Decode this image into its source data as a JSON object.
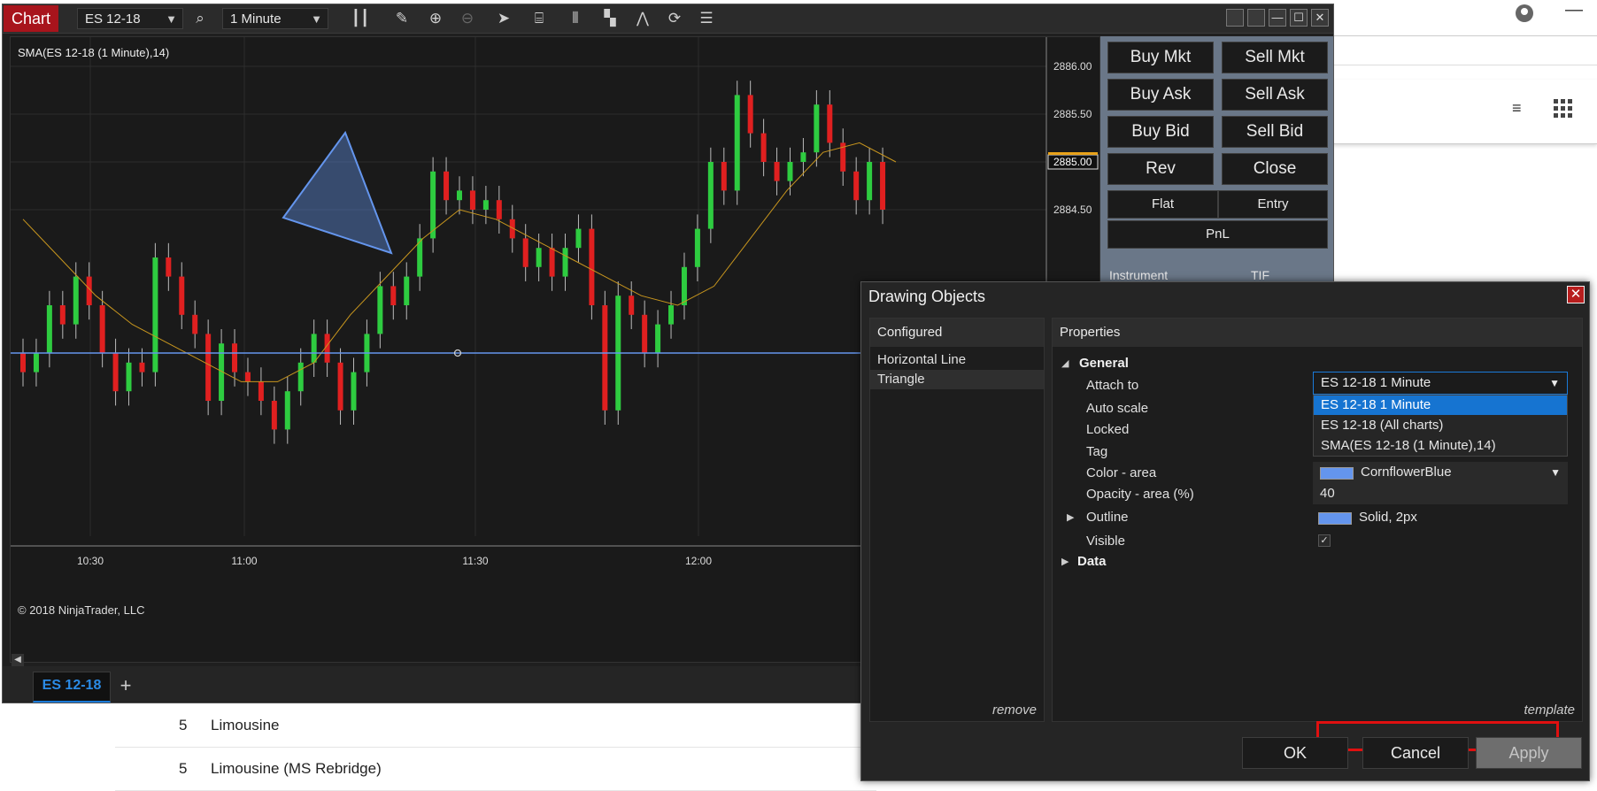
{
  "background_page": {
    "rows": [
      {
        "num": "5",
        "text": "Limousine"
      },
      {
        "num": "5",
        "text": "Limousine (MS Rebridge)"
      }
    ]
  },
  "chart_window": {
    "title_badge": "Chart",
    "instrument": "ES 12-18",
    "interval": "1 Minute",
    "indicator_label": "SMA(ES 12-18 (1 Minute),14)",
    "copyright": "© 2018 NinjaTrader, LLC",
    "active_tab": "ES 12-18",
    "add_tab_label": "+",
    "window_controls": {
      "minimize": "—",
      "maximize": "☐",
      "close": "✕"
    }
  },
  "chart_data": {
    "type": "candlestick",
    "y_axis_labels": [
      "2886.00",
      "2885.50",
      "2885.00",
      "2884.50"
    ],
    "y_ticks": [
      2886.0,
      2885.5,
      2885.0,
      2884.5
    ],
    "last_price_label": "2885.00",
    "last_price": 2885.0,
    "x_tick_labels": [
      "10:30",
      "11:00",
      "11:30",
      "12:00"
    ],
    "horizontal_line_price": 2883.0,
    "sma_color": "#c8961e",
    "up_color": "#2ecc40",
    "down_color": "#e02020",
    "horizontal_line_color": "#6495ed",
    "triangle_color": "#6495ed",
    "candles": [
      {
        "o": 2883.0,
        "c": 2882.8
      },
      {
        "o": 2882.8,
        "c": 2883.0
      },
      {
        "o": 2883.0,
        "c": 2883.5
      },
      {
        "o": 2883.5,
        "c": 2883.3
      },
      {
        "o": 2883.3,
        "c": 2883.8
      },
      {
        "o": 2883.8,
        "c": 2883.5
      },
      {
        "o": 2883.5,
        "c": 2883.0
      },
      {
        "o": 2883.0,
        "c": 2882.6
      },
      {
        "o": 2882.6,
        "c": 2882.9
      },
      {
        "o": 2882.9,
        "c": 2882.8
      },
      {
        "o": 2882.8,
        "c": 2884.0
      },
      {
        "o": 2884.0,
        "c": 2883.8
      },
      {
        "o": 2883.8,
        "c": 2883.4
      },
      {
        "o": 2883.4,
        "c": 2883.2
      },
      {
        "o": 2883.2,
        "c": 2882.5
      },
      {
        "o": 2882.5,
        "c": 2883.1
      },
      {
        "o": 2883.1,
        "c": 2882.8
      },
      {
        "o": 2882.8,
        "c": 2882.7
      },
      {
        "o": 2882.7,
        "c": 2882.5
      },
      {
        "o": 2882.5,
        "c": 2882.2
      },
      {
        "o": 2882.2,
        "c": 2882.6
      },
      {
        "o": 2882.6,
        "c": 2882.9
      },
      {
        "o": 2882.9,
        "c": 2883.2
      },
      {
        "o": 2883.2,
        "c": 2882.9
      },
      {
        "o": 2882.9,
        "c": 2882.4
      },
      {
        "o": 2882.4,
        "c": 2882.8
      },
      {
        "o": 2882.8,
        "c": 2883.2
      },
      {
        "o": 2883.2,
        "c": 2883.7
      },
      {
        "o": 2883.7,
        "c": 2883.5
      },
      {
        "o": 2883.5,
        "c": 2883.8
      },
      {
        "o": 2883.8,
        "c": 2884.2
      },
      {
        "o": 2884.2,
        "c": 2884.9
      },
      {
        "o": 2884.9,
        "c": 2884.6
      },
      {
        "o": 2884.6,
        "c": 2884.7
      },
      {
        "o": 2884.7,
        "c": 2884.5
      },
      {
        "o": 2884.5,
        "c": 2884.6
      },
      {
        "o": 2884.6,
        "c": 2884.4
      },
      {
        "o": 2884.4,
        "c": 2884.2
      },
      {
        "o": 2884.2,
        "c": 2883.9
      },
      {
        "o": 2883.9,
        "c": 2884.1
      },
      {
        "o": 2884.1,
        "c": 2883.8
      },
      {
        "o": 2883.8,
        "c": 2884.1
      },
      {
        "o": 2884.1,
        "c": 2884.3
      },
      {
        "o": 2884.3,
        "c": 2883.5
      },
      {
        "o": 2883.5,
        "c": 2882.4
      },
      {
        "o": 2882.4,
        "c": 2883.6
      },
      {
        "o": 2883.6,
        "c": 2883.4
      },
      {
        "o": 2883.4,
        "c": 2883.0
      },
      {
        "o": 2883.0,
        "c": 2883.3
      },
      {
        "o": 2883.3,
        "c": 2883.5
      },
      {
        "o": 2883.5,
        "c": 2883.9
      },
      {
        "o": 2883.9,
        "c": 2884.3
      },
      {
        "o": 2884.3,
        "c": 2885.0
      },
      {
        "o": 2885.0,
        "c": 2884.7
      },
      {
        "o": 2884.7,
        "c": 2885.7
      },
      {
        "o": 2885.7,
        "c": 2885.3
      },
      {
        "o": 2885.3,
        "c": 2885.0
      },
      {
        "o": 2885.0,
        "c": 2884.8
      },
      {
        "o": 2884.8,
        "c": 2885.0
      },
      {
        "o": 2885.0,
        "c": 2885.1
      },
      {
        "o": 2885.1,
        "c": 2885.6
      },
      {
        "o": 2885.6,
        "c": 2885.2
      },
      {
        "o": 2885.2,
        "c": 2884.9
      },
      {
        "o": 2884.9,
        "c": 2884.6
      },
      {
        "o": 2884.6,
        "c": 2885.0
      },
      {
        "o": 2885.0,
        "c": 2884.5
      }
    ],
    "sma": [
      2884.4,
      2884.0,
      2883.6,
      2883.3,
      2883.1,
      2882.9,
      2882.7,
      2882.7,
      2882.9,
      2883.4,
      2883.8,
      2884.2,
      2884.5,
      2884.4,
      2884.2,
      2884.0,
      2883.8,
      2883.6,
      2883.5,
      2883.7,
      2884.2,
      2884.7,
      2885.1,
      2885.2,
      2885.0
    ]
  },
  "order_panel": {
    "buttons": [
      {
        "label": "Buy Mkt"
      },
      {
        "label": "Sell Mkt"
      },
      {
        "label": "Buy Ask"
      },
      {
        "label": "Sell Ask"
      },
      {
        "label": "Buy Bid"
      },
      {
        "label": "Sell Bid"
      },
      {
        "label": "Rev"
      },
      {
        "label": "Close"
      },
      {
        "label": "Flat"
      },
      {
        "label": "Entry"
      }
    ],
    "pnl_label": "PnL",
    "instrument_label": "Instrument",
    "tif_label": "TIF"
  },
  "dialog": {
    "title": "Drawing Objects",
    "close_label": "✕",
    "configured": {
      "header": "Configured",
      "items": [
        "Horizontal Line",
        "Triangle"
      ],
      "remove_label": "remove"
    },
    "properties": {
      "header": "Properties",
      "general_label": "General",
      "data_label": "Data",
      "template_label": "template",
      "attach_to": {
        "label": "Attach to",
        "value": "ES 12-18 1 Minute",
        "options": [
          "ES 12-18 1 Minute",
          "ES 12-18 (All charts)",
          "SMA(ES 12-18 (1 Minute),14)"
        ]
      },
      "auto_scale_label": "Auto scale",
      "locked_label": "Locked",
      "tag_label": "Tag",
      "color_area": {
        "label": "Color - area",
        "value": "CornflowerBlue",
        "color": "#6495ed"
      },
      "opacity_area": {
        "label": "Opacity - area (%)",
        "value": "40"
      },
      "outline": {
        "label": "Outline",
        "value": "Solid, 2px"
      },
      "visible_label": "Visible"
    },
    "buttons": {
      "ok": "OK",
      "cancel": "Cancel",
      "apply": "Apply"
    }
  }
}
